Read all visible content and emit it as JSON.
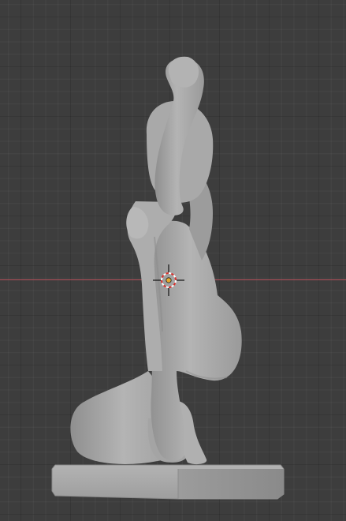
{
  "viewport": {
    "view": "3D Viewport",
    "shading": "solid",
    "background": "#3d3d3d",
    "grid_color": "#4a4a4a",
    "x_axis_color": "#b5505a",
    "model_color": "#a9a9a9",
    "origin_color": "#e8a92d",
    "cursor_ring_colors": [
      "#ffffff",
      "#d9302c"
    ]
  },
  "icons": {
    "cursor": "3d-cursor-icon",
    "origin": "object-origin-icon"
  }
}
